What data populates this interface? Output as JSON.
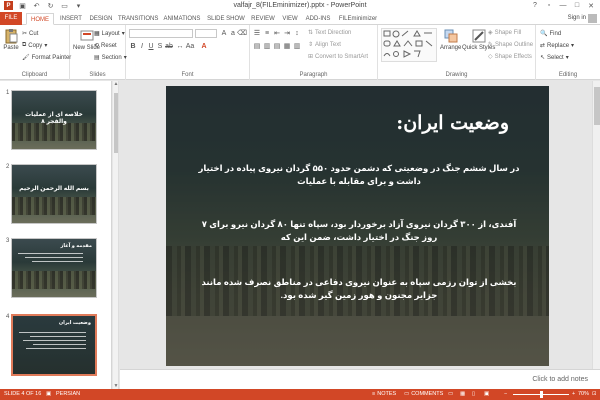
{
  "window": {
    "title": "valfajr_8(FILEminimizer).pptx - PowerPoint",
    "app_icon": "P",
    "controls": {
      "help": "?",
      "minimize": "—",
      "maximize": "□",
      "close": "✕"
    }
  },
  "tabs": [
    {
      "label": "FILE"
    },
    {
      "label": "HOME"
    },
    {
      "label": "INSERT"
    },
    {
      "label": "DESIGN"
    },
    {
      "label": "TRANSITIONS"
    },
    {
      "label": "ANIMATIONS"
    },
    {
      "label": "SLIDE SHOW"
    },
    {
      "label": "REVIEW"
    },
    {
      "label": "VIEW"
    },
    {
      "label": "ADD-INS"
    },
    {
      "label": "FILEminimizer"
    }
  ],
  "active_tab": "HOME",
  "signin": "Sign in",
  "ribbon": {
    "clipboard": {
      "label": "Clipboard",
      "paste": "Paste",
      "cut": "Cut",
      "copy": "Copy",
      "format_painter": "Format Painter"
    },
    "slides": {
      "label": "Slides",
      "new_slide": "New Slide",
      "layout": "Layout",
      "reset": "Reset",
      "section": "Section"
    },
    "font": {
      "label": "Font"
    },
    "paragraph": {
      "label": "Paragraph",
      "text_direction": "Text Direction",
      "align_text": "Align Text",
      "convert_smartart": "Convert to SmartArt"
    },
    "drawing": {
      "label": "Drawing",
      "arrange": "Arrange",
      "quick_styles": "Quick Styles",
      "shape_fill": "Shape Fill",
      "shape_outline": "Shape Outline",
      "shape_effects": "Shape Effects"
    },
    "editing": {
      "label": "Editing",
      "find": "Find",
      "replace": "Replace",
      "select": "Select"
    }
  },
  "thumbnails": [
    {
      "number": "1",
      "text": "خلاصه ای از عملیات والفجر ۸"
    },
    {
      "number": "2",
      "text": "بسم الله الرحمن الرحيم"
    },
    {
      "number": "3",
      "text": "مقدمه و آغاز"
    },
    {
      "number": "4",
      "text": "وضعیت ایران"
    }
  ],
  "slide": {
    "title": "وضعیت ایران:",
    "bullets": [
      "در سال ششم جنگ در وضعیتی که دشمن حدود ۵۵۰ گردان نیروی پیاده در اختیار داشت و برای مقابله با عملیات",
      "آفندی، از ۳۰۰ گردان نیروی آزاد برخوردار بود، سپاه تنها ۸۰ گردان نیرو برای ۷ روز جنگ در اختیار داشت، ضمن این که",
      "بخشی از توان رزمی سپاه به عنوان نیروی دفاعی در مناطق نصرف شده مانند جزایر مجنون و هور زمین گیر شده بود."
    ]
  },
  "notes_placeholder": "Click to add notes",
  "status": {
    "slide_of": "SLIDE 4 OF 16",
    "language": "PERSIAN",
    "notes": "NOTES",
    "comments": "COMMENTS",
    "zoom": "70%"
  }
}
